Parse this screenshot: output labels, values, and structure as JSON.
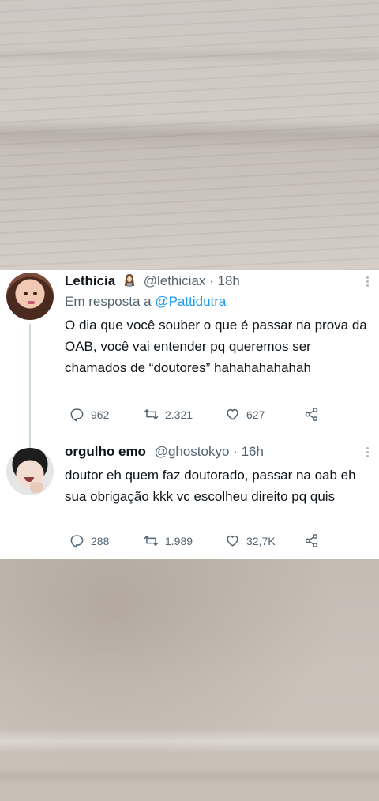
{
  "tweets": [
    {
      "name": "Lethicia",
      "handle": "@lethiciax",
      "time": "· 18h",
      "reply_prefix": "Em resposta a",
      "reply_mention": "@Pattidutra",
      "text": "O dia que você souber o que é passar na prova da OAB, você vai entender pq queremos ser chamados de “doutores” hahahahahahah",
      "replies": "962",
      "retweets": "2.321",
      "likes": "627"
    },
    {
      "name": "orgulho emo",
      "handle": "@ghostokyo",
      "time": "· 16h",
      "text": "doutor eh quem faz doutorado, passar na oab eh sua obrigação kkk vc escolheu direito pq quis",
      "replies": "288",
      "retweets": "1.989",
      "likes": "32,7K"
    }
  ],
  "icons": {
    "badge": "woman-emoji-icon",
    "reply": "reply-icon",
    "retweet": "retweet-icon",
    "like": "heart-icon",
    "share": "share-icon",
    "more": "more-dots-icon"
  },
  "colors": {
    "link": "#1d9bf0",
    "secondary": "#536471",
    "text": "#0f1419"
  }
}
